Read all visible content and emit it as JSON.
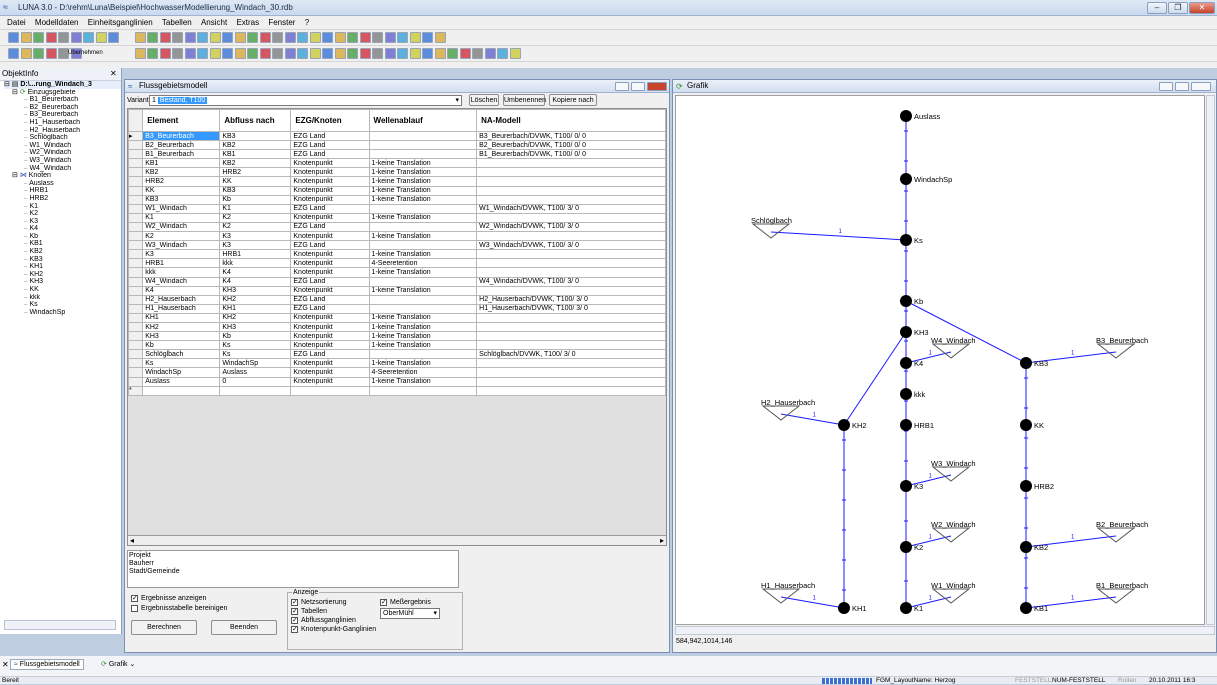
{
  "app": {
    "title": "LUNA 3.0 - D:\\rehm\\Luna\\Beispiel\\HochwasserModellierung_Windach_30.rdb"
  },
  "menu": [
    "Datei",
    "Modelldaten",
    "Einheitsganglinien",
    "Tabellen",
    "Ansicht",
    "Extras",
    "Fenster",
    "?"
  ],
  "toolbar3": {
    "uebernehmen": "Übernehmen"
  },
  "left_panel": {
    "title": "ObjektInfo",
    "root": "D:\\...rung_Windach_3",
    "group1": "Einzugsgebiete",
    "ezg": [
      "B1_Beurerbach",
      "B2_Beurerbach",
      "B3_Beurerbach",
      "H1_Hauserbach",
      "H2_Hauserbach",
      "Schlöglbach",
      "W1_Windach",
      "W2_Windach",
      "W3_Windach",
      "W4_Windach"
    ],
    "group2": "Knoten",
    "knoten": [
      "Auslass",
      "HRB1",
      "HRB2",
      "K1",
      "K2",
      "K3",
      "K4",
      "Kb",
      "KB1",
      "KB2",
      "KB3",
      "KH1",
      "KH2",
      "KH3",
      "KK",
      "kkk",
      "Ks",
      "WindachSp"
    ]
  },
  "model_window": {
    "title": "Flussgebietsmodell",
    "variante_label": "Variante:",
    "variante_num": "1",
    "variante_value": "Bestand, T100",
    "btn_loeschen": "Löschen",
    "btn_umbenennen": "Umbenennen",
    "btn_kopiere": "Kopiere nach",
    "columns": [
      "Element",
      "Abfluss nach",
      "EZG/Knoten",
      "Wellenablauf",
      "NA-Modell"
    ],
    "rows": [
      [
        "B3_Beurerbach",
        "KB3",
        "EZG Land",
        "",
        "B3_Beurerbach/DVWK, T100/ 0/ 0"
      ],
      [
        "B2_Beurerbach",
        "KB2",
        "EZG Land",
        "",
        "B2_Beurerbach/DVWK, T100/ 0/ 0"
      ],
      [
        "B1_Beurerbach",
        "KB1",
        "EZG Land",
        "",
        "B1_Beurerbach/DVWK, T100/ 0/ 0"
      ],
      [
        "KB1",
        "KB2",
        "Knotenpunkt",
        "1-keine Translation",
        ""
      ],
      [
        "KB2",
        "HRB2",
        "Knotenpunkt",
        "1-keine Translation",
        ""
      ],
      [
        "HRB2",
        "KK",
        "Knotenpunkt",
        "1-keine Translation",
        ""
      ],
      [
        "KK",
        "KB3",
        "Knotenpunkt",
        "1-keine Translation",
        ""
      ],
      [
        "KB3",
        "Kb",
        "Knotenpunkt",
        "1-keine Translation",
        ""
      ],
      [
        "W1_Windach",
        "K1",
        "EZG Land",
        "",
        "W1_Windach/DVWK, T100/ 3/ 0"
      ],
      [
        "K1",
        "K2",
        "Knotenpunkt",
        "1-keine Translation",
        ""
      ],
      [
        "W2_Windach",
        "K2",
        "EZG Land",
        "",
        "W2_Windach/DVWK, T100/ 3/ 0"
      ],
      [
        "K2",
        "K3",
        "Knotenpunkt",
        "1-keine Translation",
        ""
      ],
      [
        "W3_Windach",
        "K3",
        "EZG Land",
        "",
        "W3_Windach/DVWK, T100/ 3/ 0"
      ],
      [
        "K3",
        "HRB1",
        "Knotenpunkt",
        "1-keine Translation",
        ""
      ],
      [
        "HRB1",
        "kkk",
        "Knotenpunkt",
        "4-Seeretention",
        ""
      ],
      [
        "kkk",
        "K4",
        "Knotenpunkt",
        "1-keine Translation",
        ""
      ],
      [
        "W4_Windach",
        "K4",
        "EZG Land",
        "",
        "W4_Windach/DVWK, T100/ 3/ 0"
      ],
      [
        "K4",
        "KH3",
        "Knotenpunkt",
        "1-keine Translation",
        ""
      ],
      [
        "H2_Hauserbach",
        "KH2",
        "EZG Land",
        "",
        "H2_Hauserbach/DVWK, T100/ 3/ 0"
      ],
      [
        "H1_Hauserbach",
        "KH1",
        "EZG Land",
        "",
        "H1_Hauserbach/DVWK, T100/ 3/ 0"
      ],
      [
        "KH1",
        "KH2",
        "Knotenpunkt",
        "1-keine Translation",
        ""
      ],
      [
        "KH2",
        "KH3",
        "Knotenpunkt",
        "1-keine Translation",
        ""
      ],
      [
        "KH3",
        "Kb",
        "Knotenpunkt",
        "1-keine Translation",
        ""
      ],
      [
        "Kb",
        "Ks",
        "Knotenpunkt",
        "1-keine Translation",
        ""
      ],
      [
        "Schlöglbach",
        "Ks",
        "EZG Land",
        "",
        "Schlöglbach/DVWK, T100/ 3/ 0"
      ],
      [
        "Ks",
        "WindachSp",
        "Knotenpunkt",
        "1-keine Translation",
        ""
      ],
      [
        "WindachSp",
        "Auslass",
        "Knotenpunkt",
        "4-Seeretention",
        ""
      ],
      [
        "Auslass",
        "0",
        "Knotenpunkt",
        "1-keine Translation",
        ""
      ]
    ],
    "new_row_marker": "*",
    "selected_marker": "▸",
    "info_lines": [
      "Projekt",
      "Bauherr",
      "Stadt/Gemeinde"
    ],
    "chk_ergebnisse": "Ergebnisse anzeigen",
    "chk_bereinigen": "Ergebnisstabelle bereinigen",
    "anzeige_label": "Anzeige",
    "chk_netzsortierung": "Netzsortierung",
    "chk_tabellen": "Tabellen",
    "chk_abfluss": "Abflussganglinien",
    "chk_knoten": "Knotenpunkt-Ganglinien",
    "chk_messergebnis": "Meßergebnis",
    "messstelle": "OberMühl",
    "btn_berechnen": "Berechnen",
    "btn_beenden": "Beenden"
  },
  "graphic_window": {
    "title": "Grafik",
    "coord": "584,942,1014,146",
    "edge_label": "1",
    "nodes": {
      "Auslass": "Auslass",
      "WindachSp": "WindachSp",
      "Ks": "Ks",
      "Kb": "Kb",
      "KH3": "KH3",
      "K4": "K4",
      "kkk": "kkk",
      "HRB1": "HRB1",
      "K3": "K3",
      "K2": "K2",
      "K1": "K1",
      "KH2": "KH2",
      "KH1": "KH1",
      "KB3": "KB3",
      "KK": "KK",
      "HRB2": "HRB2",
      "KB2": "KB2",
      "KB1": "KB1"
    },
    "catchments": {
      "Schloeglbach": "Schlöglbach",
      "W4": "W4_Windach",
      "W3": "W3_Windach",
      "W2": "W2_Windach",
      "W1": "W1_Windach",
      "H2": "H2_Hauserbach",
      "H1": "H1_Hauserbach",
      "B3": "B3_Beurerbach",
      "B2": "B2_Beurerbach",
      "B1": "B1_Beurerbach"
    }
  },
  "tabs": [
    "Flussgebietsmodell",
    "Grafik"
  ],
  "status": {
    "left": "Bereit",
    "layout": "FGM_LayoutName: Herzog",
    "feststell": "FESTSTELL",
    "num": "NUM-FESTSTELL",
    "rollen": "Rollen",
    "datetime": "20.10.2011 16:3"
  },
  "colors": {
    "selection": "#3399ff",
    "network": "#1a1aff",
    "node": "#000000"
  }
}
